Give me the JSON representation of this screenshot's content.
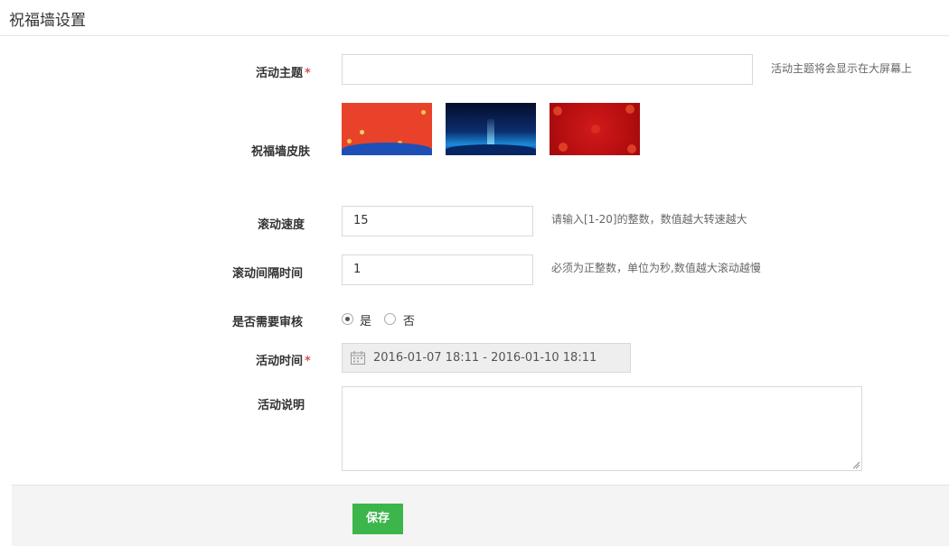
{
  "page": {
    "title": "祝福墙设置"
  },
  "form": {
    "topic": {
      "label": "活动主题",
      "required_mark": "*",
      "value": "",
      "hint": "活动主题将会显示在大屏幕上"
    },
    "skin": {
      "label": "祝福墙皮肤",
      "options": [
        "red-festive-skin",
        "blue-night-skin",
        "red-floral-skin"
      ]
    },
    "speed": {
      "label": "滚动速度",
      "value": "15",
      "hint": "请输入[1-20]的整数，数值越大转速越大"
    },
    "interval": {
      "label": "滚动间隔时间",
      "value": "1",
      "hint": "必须为正整数，单位为秒,数值越大滚动越慢"
    },
    "review": {
      "label": "是否需要审核",
      "options": [
        {
          "label": "是",
          "checked": true
        },
        {
          "label": "否",
          "checked": false
        }
      ]
    },
    "time": {
      "label": "活动时间",
      "required_mark": "*",
      "value": "2016-01-07 18:11 - 2016-01-10 18:11",
      "icon": "calendar-icon"
    },
    "description": {
      "label": "活动说明",
      "value": ""
    }
  },
  "footer": {
    "save_label": "保存"
  },
  "colors": {
    "accent": "#3cb54a",
    "required": "#d9534f"
  }
}
